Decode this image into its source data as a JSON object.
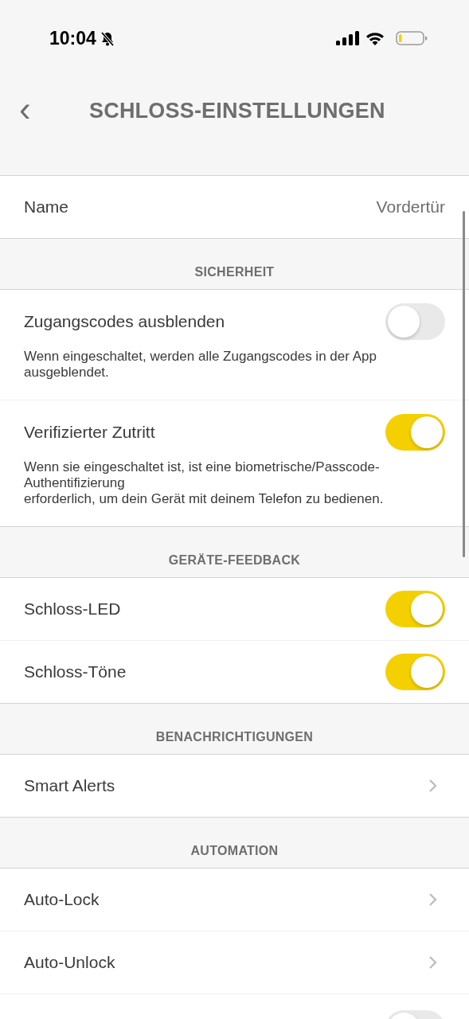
{
  "status_bar": {
    "time": "10:04",
    "silent": true
  },
  "header": {
    "back": "‹",
    "title": "SCHLOSS-EINSTELLUNGEN"
  },
  "sections": [
    {
      "rows": [
        {
          "kind": "value",
          "label": "Name",
          "value": "Vordertür"
        }
      ]
    },
    {
      "title": "SICHERHEIT",
      "rows": [
        {
          "kind": "toggle",
          "label": "Zugangscodes ausblenden",
          "on": false,
          "description": "Wenn eingeschaltet, werden alle Zugangscodes in der App ausgeblendet."
        },
        {
          "kind": "toggle",
          "label": "Verifizierter Zutritt",
          "on": true,
          "description": "Wenn sie eingeschaltet ist, ist eine biometrische/Passcode-Authentifizierung\nerforderlich, um dein Gerät mit deinem Telefon zu bedienen."
        }
      ]
    },
    {
      "title": "GERÄTE-FEEDBACK",
      "rows": [
        {
          "kind": "toggle",
          "label": "Schloss-LED",
          "on": true
        },
        {
          "kind": "toggle",
          "label": "Schloss-Töne",
          "on": true
        }
      ]
    },
    {
      "title": "BENACHRICHTIGUNGEN",
      "rows": [
        {
          "kind": "link",
          "label": "Smart Alerts"
        }
      ]
    },
    {
      "title": "AUTOMATION",
      "rows": [
        {
          "kind": "link",
          "label": "Auto-Lock"
        },
        {
          "kind": "link",
          "label": "Auto-Unlock"
        },
        {
          "kind": "toggle",
          "on": false
        }
      ]
    }
  ]
}
